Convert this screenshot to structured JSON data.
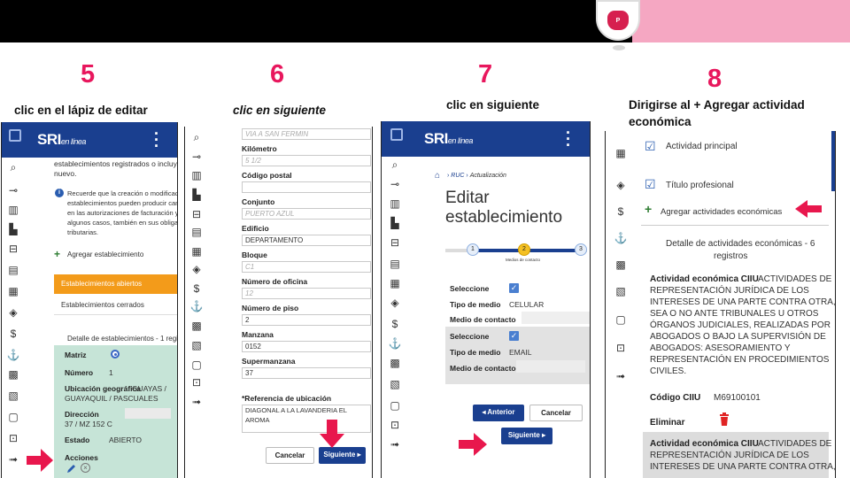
{
  "steps": [
    {
      "num": "5",
      "caption": "clic en el lápiz de editar"
    },
    {
      "num": "6",
      "caption": "clic en siguiente"
    },
    {
      "num": "7",
      "caption": "clic en siguiente"
    },
    {
      "num": "8",
      "caption": "Dirigirse al + Agregar actividad económica"
    }
  ],
  "brand": {
    "logo_text": "SRI",
    "logo_sub": "en línea",
    "logo_badge": "P",
    "accent": "#e8175d",
    "header_blue": "#1a3f8f"
  },
  "s5": {
    "intro": "establecimientos registrados o incluya",
    "intro2": "nuevo.",
    "notice": [
      "Recuerde que la creación o modificació",
      "establecimientos pueden producir cam",
      "en las autorizaciones de facturación y",
      "algunos casos, también en sus obligac",
      "tributarias."
    ],
    "add": "Agregar establecimiento",
    "tab_open": "Establecimientos abiertos",
    "tab_closed": "Establecimientos cerrados",
    "detail_title": "Detalle de establecimientos - 1 registr",
    "matriz": "Matriz",
    "numero_l": "Número",
    "numero_v": "1",
    "ubic_l": "Ubicación geográfica",
    "ubic_v": "GUAYAS /",
    "ubic_v2": "GUAYAQUIL / PASCUALES",
    "dir_l": "Dirección",
    "dir_v": "37 / MZ 152 C",
    "estado_l": "Estado",
    "estado_v": "ABIERTO",
    "acciones_l": "Acciones"
  },
  "s6": {
    "f_top": "VIA A SAN FERMIN",
    "km_l": "Kilómetro",
    "km_v": "5 1/2",
    "cp_l": "Código postal",
    "cp_v": "",
    "conj_l": "Conjunto",
    "conj_v": "PUERTO AZUL",
    "edif_l": "Edificio",
    "edif_v": "DEPARTAMENTO",
    "bloq_l": "Bloque",
    "bloq_v": "C1",
    "ofi_l": "Número de oficina",
    "ofi_v": "12",
    "piso_l": "Número de piso",
    "piso_v": "2",
    "manz_l": "Manzana",
    "manz_v": "0152",
    "super_l": "Supermanzana",
    "super_v": "37",
    "ref_l": "*Referencia de ubicación",
    "ref_v": "DIAGONAL A LA LAVANDERIA EL AROMA",
    "cancel": "Cancelar",
    "next": "Siguiente"
  },
  "s7": {
    "crumb_ruc": "RUC",
    "crumb_act": "Actualización",
    "title1": "Editar",
    "title2": "establecimiento",
    "step1": "1",
    "step2": "2",
    "step3": "3",
    "step_label": "Medios de contacto",
    "sel_l": "Seleccione",
    "tipo_l": "Tipo de medio",
    "tipo1": "CELULAR",
    "tipo2": "EMAIL",
    "medio_l": "Medio de contacto",
    "prev": "Anterior",
    "cancel": "Cancelar",
    "next": "Siguiente"
  },
  "s8": {
    "act_principal": "Actividad principal",
    "titulo_prof": "Título profesional",
    "add_act": "Agregar actividades económicas",
    "detail1": "Detalle de actividades económicas - 6",
    "detail2": "registros",
    "act_label": "Actividad económica CIIU",
    "act_desc": [
      "ACTIVIDADES DE",
      "REPRESENTACIÓN JURÍDICA DE LOS",
      "INTERESES DE UNA PARTE CONTRA OTRA,",
      "SEA O NO ANTE TRIBUNALES U OTROS",
      "ÓRGANOS JUDICIALES, REALIZADAS POR",
      "ABOGADOS O BAJO LA SUPERVISIÓN DE",
      "ABOGADOS: ASESORAMIENTO Y",
      "REPRESENTACIÓN EN PROCEDIMIENTOS",
      "CIVILES."
    ],
    "codigo_l": "Código CIIU",
    "codigo_v": "M69100101",
    "eliminar": "Eliminar",
    "act2_desc": [
      "ACTIVIDADES DE",
      "REPRESENTACIÓN JURÍDICA DE LOS",
      "INTERESES DE UNA PARTE CONTRA OTRA,"
    ]
  }
}
